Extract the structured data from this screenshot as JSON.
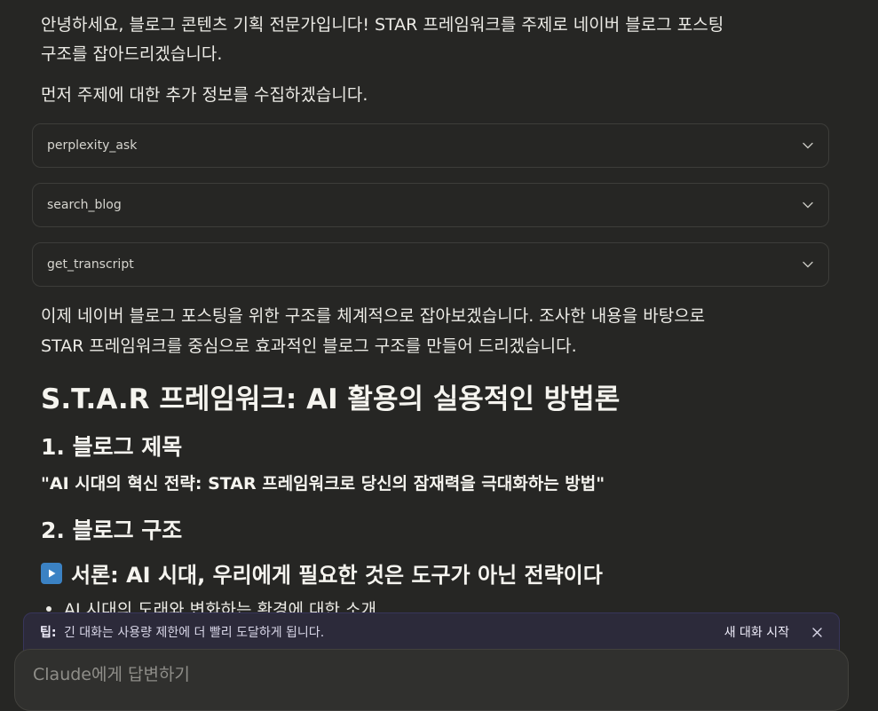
{
  "intro": {
    "line1": "안녕하세요, 블로그 콘텐츠 기획 전문가입니다! STAR 프레임워크를 주제로 네이버 블로그 포스팅",
    "line2": "구조를 잡아드리겠습니다.",
    "line3": "먼저 주제에 대한 추가 정보를 수집하겠습니다."
  },
  "tools": [
    {
      "name": "perplexity_ask"
    },
    {
      "name": "search_blog"
    },
    {
      "name": "get_transcript"
    }
  ],
  "after_tools": {
    "line1": "이제 네이버 블로그 포스팅을 위한 구조를 체계적으로 잡아보겠습니다. 조사한 내용을 바탕으로",
    "line2": "STAR 프레임워크를 중심으로 효과적인 블로그 구조를 만들어 드리겠습니다."
  },
  "heading_main": "S.T.A.R 프레임워크: AI 활용의 실용적인 방법론",
  "section1": {
    "heading": "1. 블로그 제목",
    "title_quote": "\"AI 시대의 혁신 전략: STAR 프레임워크로 당신의 잠재력을 극대화하는 방법\""
  },
  "section2": {
    "heading": "2. 블로그 구조",
    "subheading": "서론: AI 시대, 우리에게 필요한 것은 도구가 아닌 전략이다",
    "subheading_icon": "play-button-icon",
    "bullet1": "AI 시대의 도래와 변화하는 환경에 대한 소개"
  },
  "tip_banner": {
    "label": "팁:",
    "text": "긴 대화는 사용량 제한에 더 빨리 도달하게 됩니다.",
    "new_chat": "새 대화 시작",
    "bg_color": "#2c2a3a"
  },
  "composer": {
    "placeholder": "Claude에게 답변하기"
  }
}
